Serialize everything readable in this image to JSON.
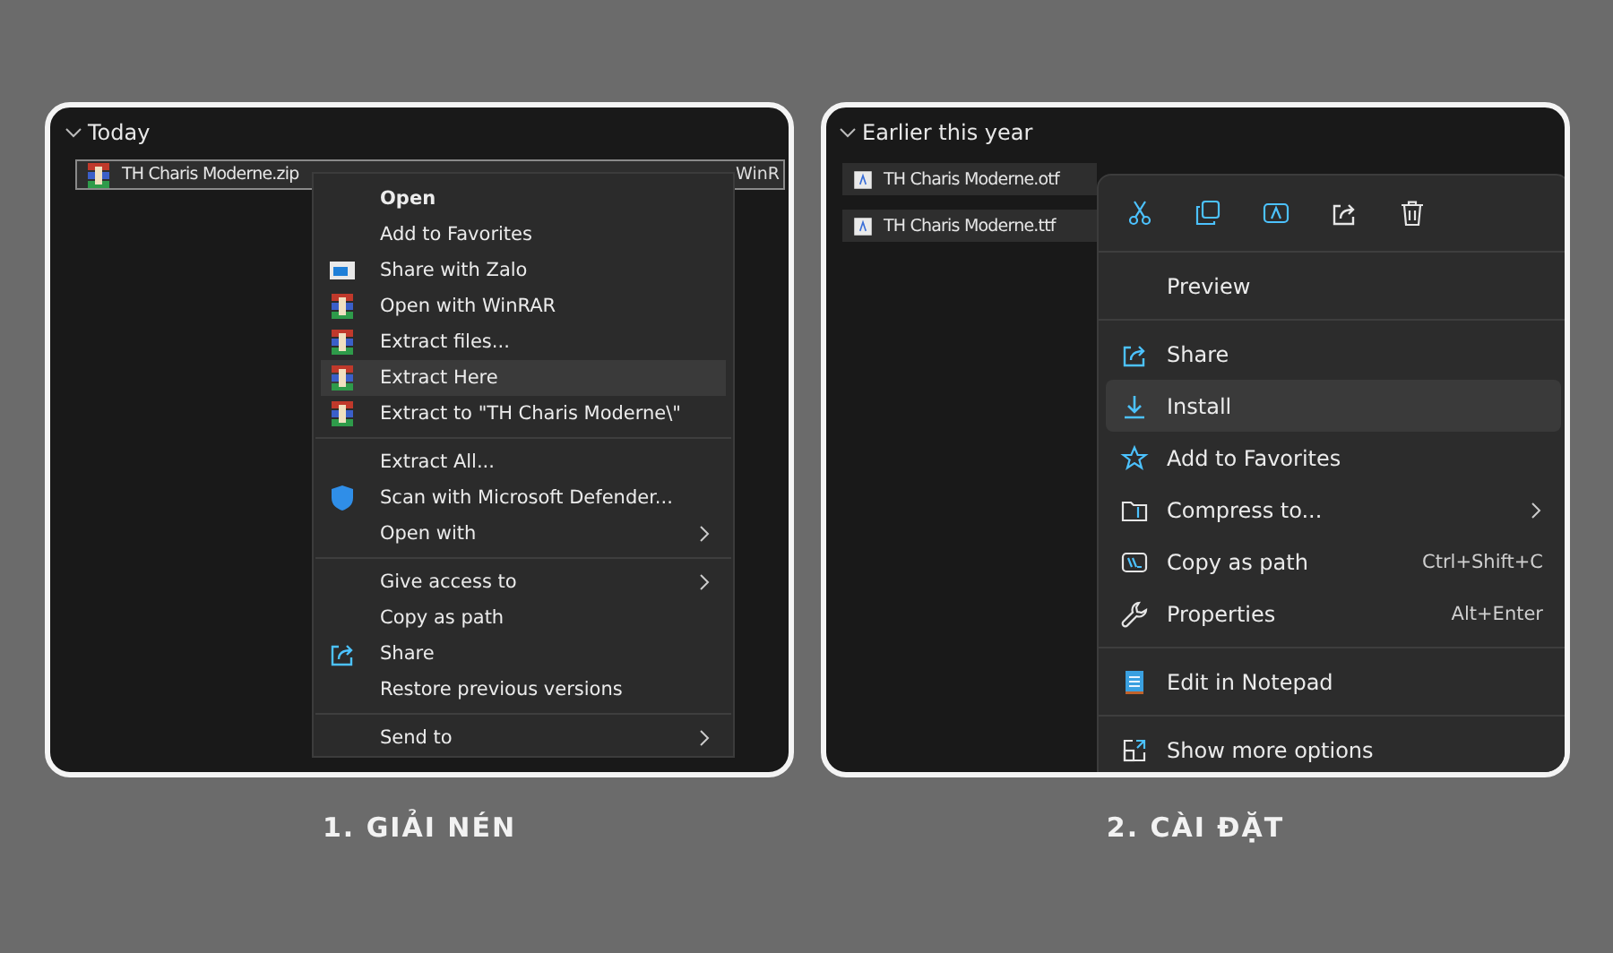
{
  "panels": [
    {
      "header": "Today",
      "caption": "1. GIẢI NÉN",
      "kind": "classic",
      "files": [
        {
          "name": "TH Charis Moderne.zip",
          "kind": "archive",
          "selected": true,
          "trailing": "WinR"
        }
      ],
      "menu": {
        "sections": [
          [
            {
              "label": "Open",
              "kind": "plain",
              "bold": true,
              "selected": false,
              "submenu": false
            },
            {
              "label": "Add to Favorites",
              "kind": "plain",
              "bold": false,
              "selected": false,
              "submenu": false
            },
            {
              "label": "Share with Zalo",
              "kind": "window",
              "bold": false,
              "selected": false,
              "submenu": false
            },
            {
              "label": "Open with WinRAR",
              "kind": "archive",
              "bold": false,
              "selected": false,
              "submenu": false
            },
            {
              "label": "Extract files...",
              "kind": "archive",
              "bold": false,
              "selected": false,
              "submenu": false
            },
            {
              "label": "Extract Here",
              "kind": "archive",
              "bold": false,
              "selected": true,
              "submenu": false
            },
            {
              "label": "Extract to \"TH Charis Moderne\\\"",
              "kind": "archive",
              "bold": false,
              "selected": false,
              "submenu": false
            }
          ],
          [
            {
              "label": "Extract All...",
              "kind": "plain",
              "bold": false,
              "selected": false,
              "submenu": false
            },
            {
              "label": "Scan with Microsoft Defender...",
              "kind": "shield",
              "bold": false,
              "selected": false,
              "submenu": false
            },
            {
              "label": "Open with",
              "kind": "plain",
              "bold": false,
              "selected": false,
              "submenu": true
            }
          ],
          [
            {
              "label": "Give access to",
              "kind": "plain",
              "bold": false,
              "selected": false,
              "submenu": true
            },
            {
              "label": "Copy as path",
              "kind": "plain",
              "bold": false,
              "selected": false,
              "submenu": false
            },
            {
              "label": "Share",
              "kind": "share",
              "bold": false,
              "selected": false,
              "submenu": false
            },
            {
              "label": "Restore previous versions",
              "kind": "plain",
              "bold": false,
              "selected": false,
              "submenu": false
            }
          ],
          [
            {
              "label": "Send to",
              "kind": "plain",
              "bold": false,
              "selected": false,
              "submenu": true
            }
          ]
        ]
      }
    },
    {
      "header": "Earlier this year",
      "caption": "2. CÀI ĐẶT",
      "kind": "modern",
      "files": [
        {
          "name": "TH Charis Moderne.otf",
          "kind": "font",
          "selected": true
        },
        {
          "name": "TH Charis Moderne.ttf",
          "kind": "font",
          "selected": true
        }
      ],
      "menu": {
        "toolbar": [
          {
            "kind": "cut"
          },
          {
            "kind": "copy"
          },
          {
            "kind": "rename"
          },
          {
            "kind": "share"
          },
          {
            "kind": "delete"
          }
        ],
        "sections": [
          [
            {
              "label": "Preview",
              "kind": "plain",
              "bold": false,
              "selected": false,
              "submenu": false
            }
          ],
          [
            {
              "label": "Share",
              "kind": "share",
              "bold": false,
              "selected": false,
              "submenu": false
            },
            {
              "label": "Install",
              "kind": "install",
              "bold": false,
              "selected": true,
              "submenu": false
            },
            {
              "label": "Add to Favorites",
              "kind": "star",
              "bold": false,
              "selected": false,
              "submenu": false
            },
            {
              "label": "Compress to...",
              "kind": "compress",
              "bold": false,
              "selected": false,
              "submenu": true
            },
            {
              "label": "Copy as path",
              "kind": "path",
              "bold": false,
              "selected": false,
              "submenu": false,
              "shortcut": "Ctrl+Shift+C"
            },
            {
              "label": "Properties",
              "kind": "wrench",
              "bold": false,
              "selected": false,
              "submenu": false,
              "shortcut": "Alt+Enter"
            }
          ],
          [
            {
              "label": "Edit in Notepad",
              "kind": "notepad",
              "bold": false,
              "selected": false,
              "submenu": false
            }
          ],
          [
            {
              "label": "Show more options",
              "kind": "more",
              "bold": false,
              "selected": false,
              "submenu": false
            }
          ]
        ]
      }
    }
  ]
}
